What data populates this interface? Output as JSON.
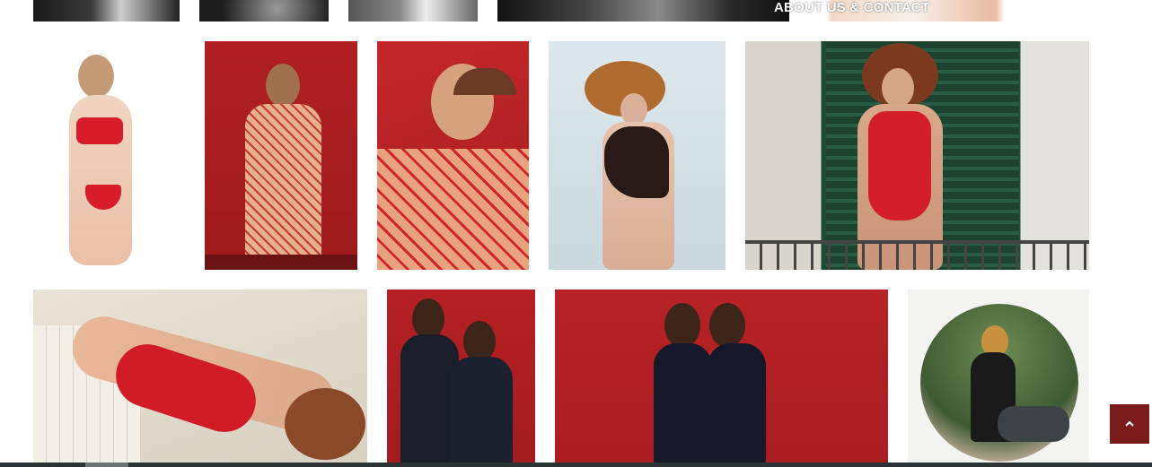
{
  "header": {
    "nav_overlay_text": "ABOUT US & CONTACT"
  },
  "gallery": {
    "row1_partial": [
      {
        "name": "photo-bw-1"
      },
      {
        "name": "photo-bw-2"
      },
      {
        "name": "photo-bw-3"
      },
      {
        "name": "photo-bw-4"
      },
      {
        "name": "photo-legs"
      }
    ],
    "row2": [
      {
        "name": "photo-red-lingerie-braids"
      },
      {
        "name": "photo-red-fishnet-bodysuit"
      },
      {
        "name": "photo-fishnet-closeup"
      },
      {
        "name": "photo-black-corset-curly"
      },
      {
        "name": "photo-red-swimsuit-balcony"
      }
    ],
    "row3": [
      {
        "name": "photo-red-swimsuit-reclining"
      },
      {
        "name": "photo-two-models-black-swimsuits"
      },
      {
        "name": "photo-two-models-red-backdrop"
      },
      {
        "name": "photo-round-portrait-car"
      }
    ]
  },
  "controls": {
    "back_to_top_icon": "chevron-up-icon"
  },
  "colors": {
    "accent": "#7a1c1c",
    "red_backdrop": "#b01f22",
    "bottom_bar": "#2b3335"
  }
}
